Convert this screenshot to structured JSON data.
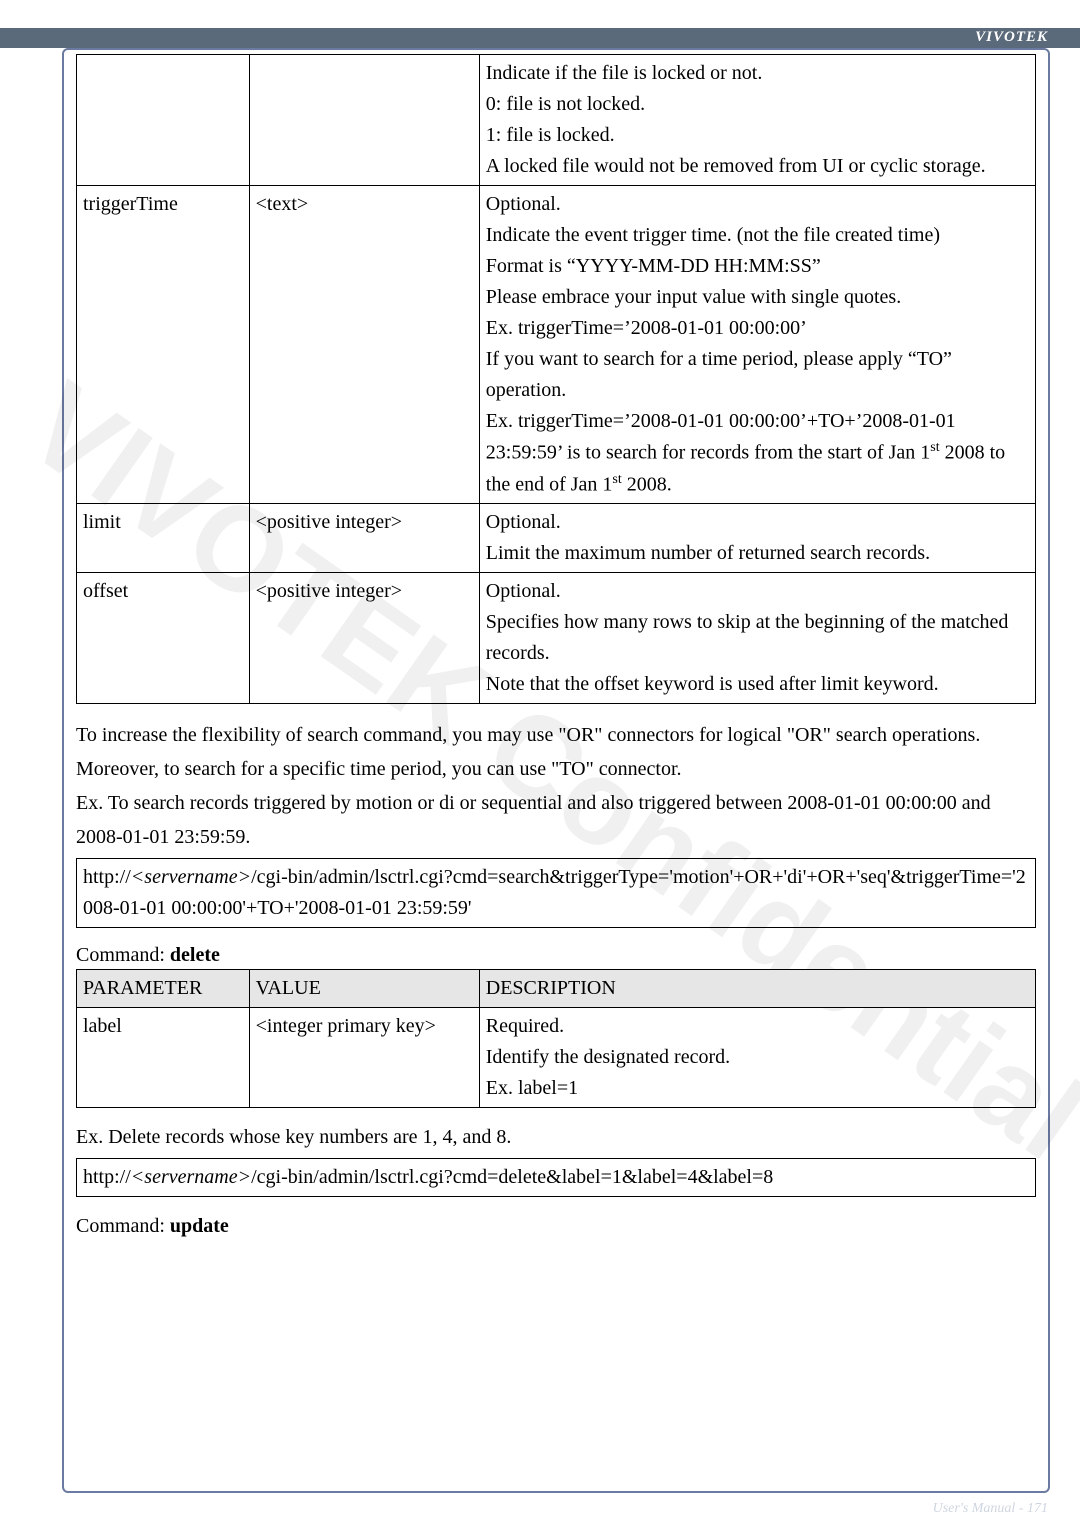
{
  "brand": "VIVOTEK",
  "watermark": "VIVOTEK Confidential",
  "footer": "User's Manual - 171",
  "table1": {
    "rows": [
      {
        "param": "",
        "value": "",
        "desc": "Indicate if the file is locked or not.\n0: file is not locked.\n1: file is locked.\nA locked file would not be removed from UI or cyclic storage."
      },
      {
        "param": "triggerTime",
        "value": "<text>",
        "desc": "Optional.\nIndicate the event trigger time. (not the file created time)\nFormat is \"YYYY-MM-DD HH:MM:SS\"\nPlease embrace your input value with single quotes.\nEx. triggerTime='2008-01-01 00:00:00'\nIf you want to search for a time period, please apply \"TO\" operation.\nEx. triggerTime='2008-01-01 00:00:00'+TO+'2008-01-01 23:59:59' is to search for records from the start of Jan 1st 2008 to the end of Jan 1st 2008."
      },
      {
        "param": "limit",
        "value": "<positive integer>",
        "desc": "Optional.\nLimit the maximum number of returned search records."
      },
      {
        "param": "offset",
        "value": "<positive integer>",
        "desc": "Optional.\nSpecifies how many rows to skip at the beginning of the matched records.\nNote that the offset keyword is used after limit keyword."
      }
    ]
  },
  "para1": "To increase the flexibility of search command, you may use \"OR\" connectors for logical \"OR\" search operations. Moreover, to search for a specific time period, you can use \"TO\" connector.",
  "para2_prefix": "Ex. To search records triggered by motion or di or sequential and also triggered between 2008-01-01 00:00:00 and 2008-01-01 23:59:59.",
  "url1_a": "http://",
  "url1_server": "<servername>",
  "url1_b": "/cgi-bin/admin/lsctrl.cgi?cmd=search&triggerType='motion'+OR+'di'+OR+'seq'&triggerTime='2008-01-01 00:00:00'+TO+'2008-01-01 23:59:59'",
  "cmd_delete_label": "Command: ",
  "cmd_delete_name": "delete",
  "table2": {
    "head": {
      "param": "PARAMETER",
      "value": "VALUE",
      "desc": "DESCRIPTION"
    },
    "row": {
      "param": "label",
      "value": "<integer primary key>",
      "desc": "Required.\nIdentify the designated record.\nEx. label=1"
    }
  },
  "para3": "Ex. Delete records whose key numbers are 1, 4, and 8.",
  "url2_a": "http://",
  "url2_server": "<servername>",
  "url2_b": "/cgi-bin/admin/lsctrl.cgi?cmd=delete&label=1&label=4&label=8",
  "cmd_update_label": "Command: ",
  "cmd_update_name": "update"
}
